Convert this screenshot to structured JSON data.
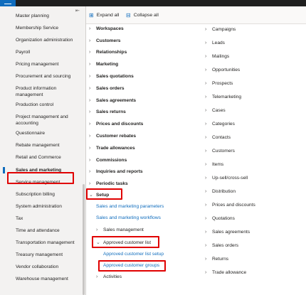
{
  "toolbar": {
    "expand_all": "Expand all",
    "collapse_all": "Collapse all"
  },
  "nav": {
    "items": [
      "Master planning",
      "Membership Service",
      "Organization administration",
      "Payroll",
      "Pricing management",
      "Procurement and sourcing",
      "Product information management",
      "Production control",
      "Project management and accounting",
      "Questionnaire",
      "Rebate management",
      "Retail and Commerce",
      "Sales and marketing",
      "Service management",
      "Subscription billing",
      "System administration",
      "Tax",
      "Time and attendance",
      "Transportation management",
      "Treasury management",
      "Vendor collaboration",
      "Warehouse management"
    ]
  },
  "left_groups": [
    "Workspaces",
    "Customers",
    "Relationships",
    "Marketing",
    "Sales quotations",
    "Sales orders",
    "Sales agreements",
    "Sales returns",
    "Prices and discounts",
    "Customer rebates",
    "Trade allowances",
    "Commissions",
    "Inquiries and reports",
    "Periodic tasks"
  ],
  "setup": {
    "label": "Setup",
    "links": [
      "Sales and marketing parameters",
      "Sales and marketing workflows"
    ],
    "sales_management": "Sales management",
    "approved_list": "Approved customer list",
    "approved_links": [
      "Approved customer list setup",
      "Approved customer groups"
    ],
    "activities": "Activities"
  },
  "right_groups": [
    "Campaigns",
    "Leads",
    "Mailings",
    "Opportunities",
    "Prospects",
    "Telemarketing",
    "Cases",
    "Categories",
    "Contacts",
    "Customers",
    "Items",
    "Up-sell/cross-sell",
    "Distribution",
    "Prices and discounts",
    "Quotations",
    "Sales agreements",
    "Sales orders",
    "Returns",
    "Trade allowance"
  ]
}
